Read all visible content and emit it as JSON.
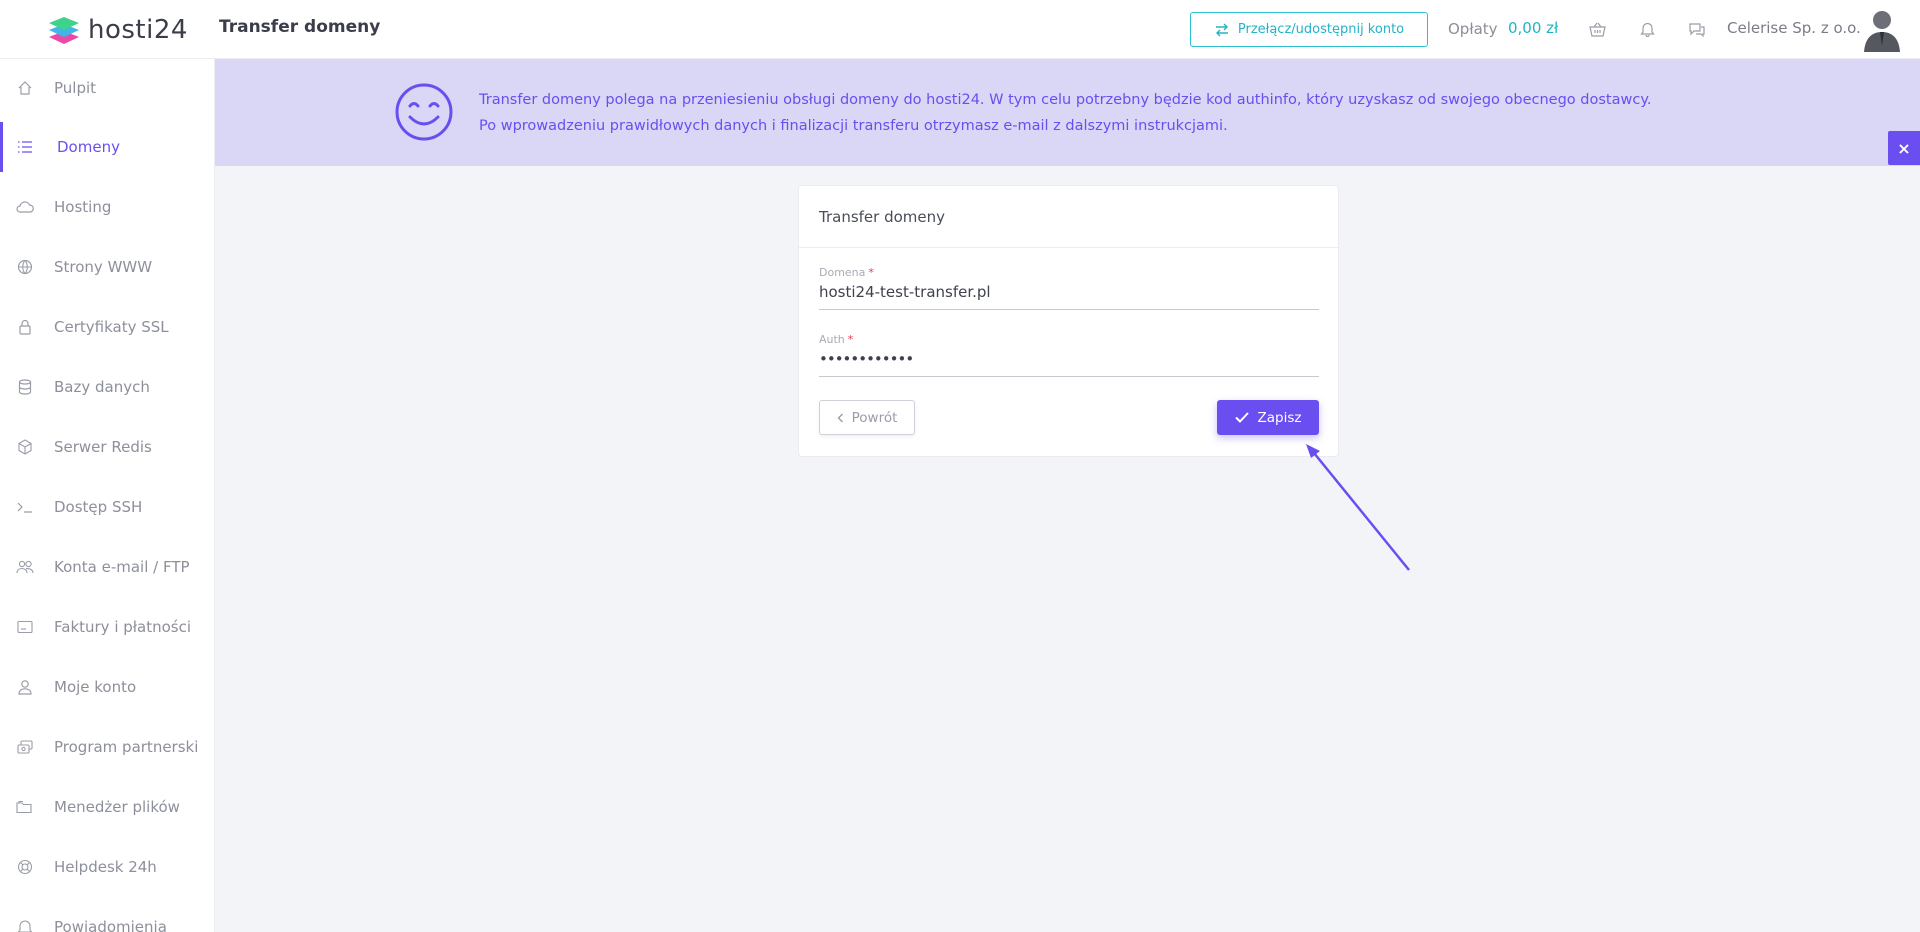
{
  "header": {
    "logo_text": "hosti24",
    "page_title": "Transfer domeny",
    "switch_account_label": "Przełącz/udostępnij konto",
    "fees_label": "Opłaty",
    "fees_value": "0,00 zł",
    "company_name": "Celerise Sp. z o.o.",
    "icons": [
      "basket-icon",
      "bell-icon",
      "chat-icon"
    ]
  },
  "sidebar": {
    "items": [
      {
        "label": "Pulpit",
        "icon": "home-icon"
      },
      {
        "label": "Domeny",
        "icon": "list-icon",
        "active": true
      },
      {
        "label": "Hosting",
        "icon": "cloud-icon"
      },
      {
        "label": "Strony WWW",
        "icon": "globe-icon"
      },
      {
        "label": "Certyfikaty SSL",
        "icon": "lock-icon"
      },
      {
        "label": "Bazy danych",
        "icon": "database-icon"
      },
      {
        "label": "Serwer Redis",
        "icon": "cube-icon"
      },
      {
        "label": "Dostęp SSH",
        "icon": "terminal-icon"
      },
      {
        "label": "Konta e-mail / FTP",
        "icon": "users-icon"
      },
      {
        "label": "Faktury i płatności",
        "icon": "invoice-icon"
      },
      {
        "label": "Moje konto",
        "icon": "user-icon"
      },
      {
        "label": "Program partnerski",
        "icon": "money-icon"
      },
      {
        "label": "Menedżer plików",
        "icon": "folder-icon"
      },
      {
        "label": "Helpdesk 24h",
        "icon": "lifebuoy-icon"
      },
      {
        "label": "Powiadomienia",
        "icon": "bell-icon"
      }
    ]
  },
  "banner": {
    "line1": "Transfer domeny polega na przeniesieniu obsługi domeny do hosti24. W tym celu potrzebny będzie kod authinfo, który uzyskasz od swojego obecnego dostawcy.",
    "line2": "Po wprowadzeniu prawidłowych danych i finalizacji transferu otrzymasz e-mail z dalszymi instrukcjami.",
    "close_label": "×"
  },
  "form": {
    "title": "Transfer domeny",
    "domain_label": "Domena",
    "domain_value": "hosti24-test-transfer.pl",
    "auth_label": "Auth",
    "auth_value": "••••••••••••",
    "required_mark": "*",
    "back_label": "Powrót",
    "save_label": "Zapisz"
  },
  "colors": {
    "accent": "#6a4ef0",
    "teal": "#22b3c6",
    "banner_bg": "#d9d6f6",
    "page_bg": "#f3f4f8"
  }
}
